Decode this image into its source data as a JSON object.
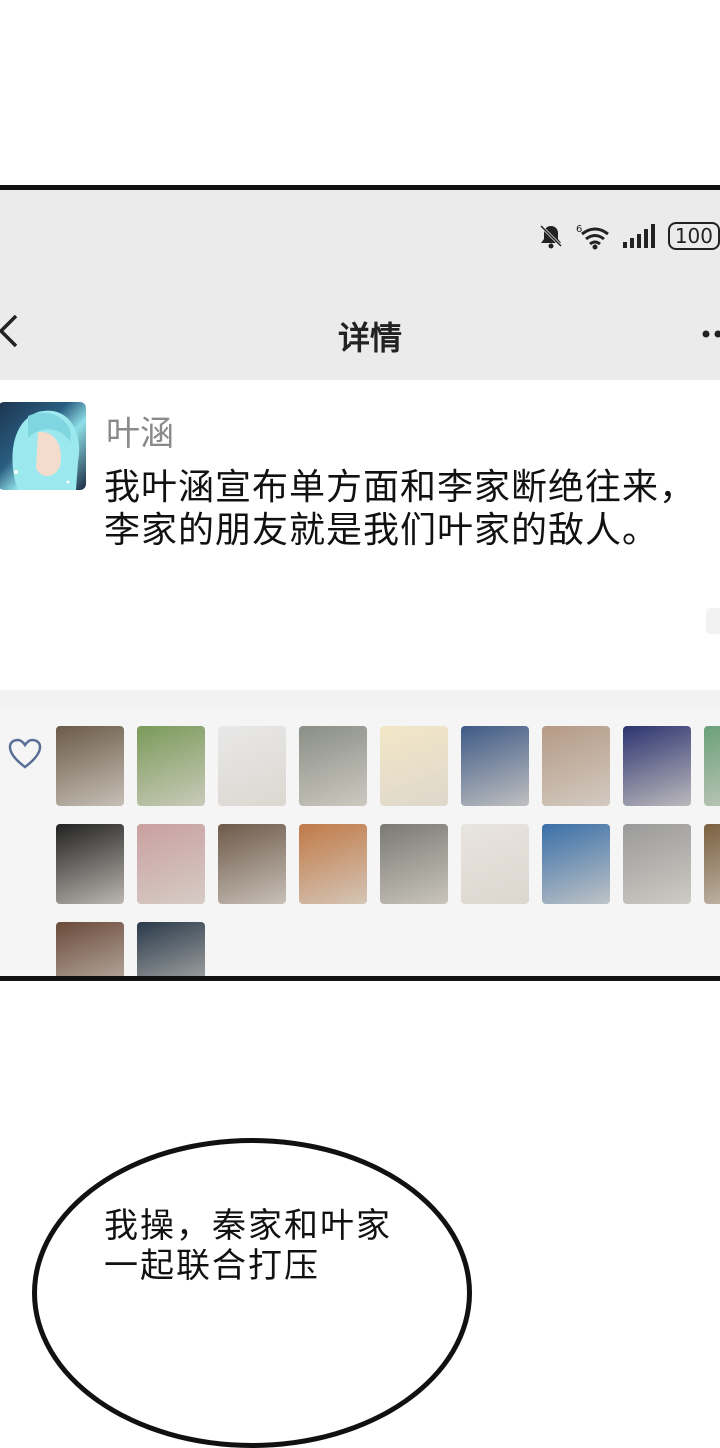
{
  "status_bar": {
    "network_label": "6",
    "battery_label": "100"
  },
  "nav": {
    "title": "详情"
  },
  "post": {
    "author": "叶涵",
    "text": "我叶涵宣布单方面和李家断绝往来，李家的朋友就是我们叶家的敌人。"
  },
  "likes": {
    "avatar_colors": [
      "#6b5a48",
      "#7a9a5a",
      "#e8e8e8",
      "#8a8f86",
      "#f3e7c7",
      "#3f5a86",
      "#b59a86",
      "#2c3470",
      "#6aa07a",
      "#222222",
      "#c9a0a0",
      "#6e5a4a",
      "#c07a48",
      "#7a7a72",
      "#e8e4de",
      "#3a6fa8",
      "#9a9a9a",
      "#7a6040",
      "#6a4a3a",
      "#2a3a4a"
    ]
  },
  "bubble": {
    "text": "我操，秦家和叶家一起联合打压"
  },
  "colors": {
    "header_bg": "#ebebeb",
    "post_bg": "#ffffff",
    "likes_bg": "#f5f5f5",
    "link_blue": "#5a6f96"
  }
}
